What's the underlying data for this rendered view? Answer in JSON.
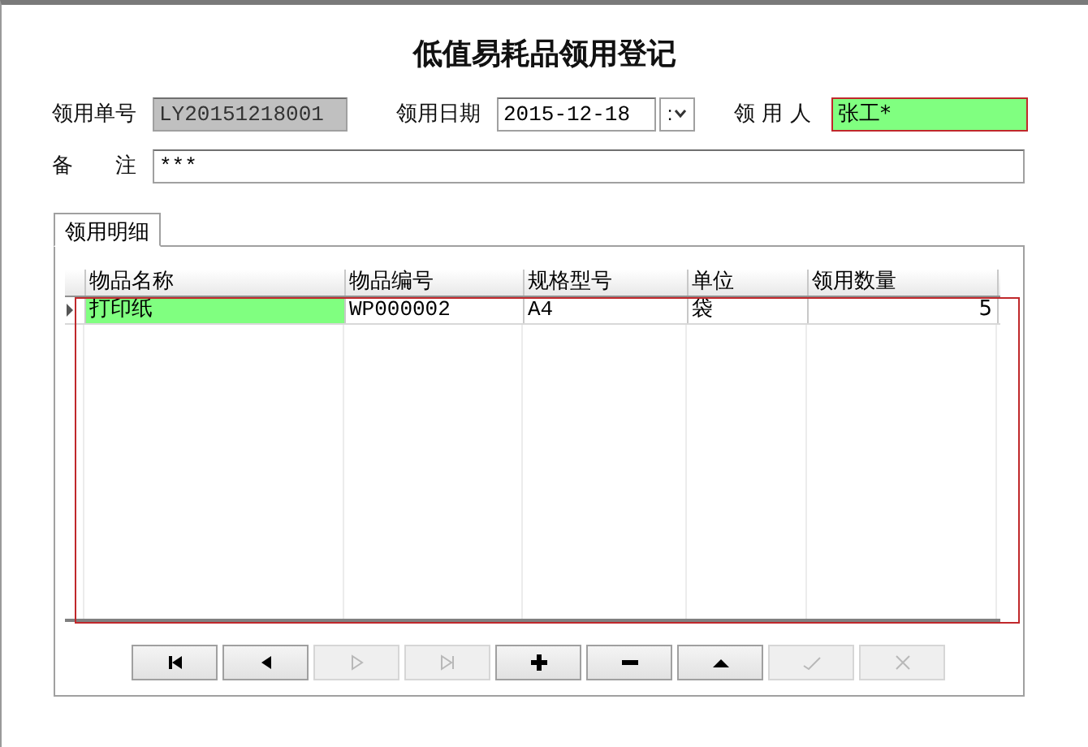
{
  "title": "低值易耗品领用登记",
  "form": {
    "order_no": {
      "label": "领用单号",
      "value": "LY20151218001",
      "disabled": true
    },
    "date": {
      "label": "领用日期",
      "value": "2015-12-18",
      "dropdown": ":"
    },
    "person": {
      "label": "领 用 人",
      "value": "张工*",
      "highlighted": true
    },
    "note": {
      "label": "备　　注",
      "value": "***"
    }
  },
  "tabs": [
    {
      "label": "领用明细",
      "selected": true
    }
  ],
  "table": {
    "columns": [
      "物品名称",
      "物品编号",
      "规格型号",
      "单位",
      "领用数量"
    ],
    "rows": [
      {
        "cells": [
          "打印纸",
          "WP000002",
          "A4",
          "袋",
          "5"
        ],
        "selected": true
      }
    ],
    "highlighted": true
  },
  "navigator": [
    {
      "kind": "first",
      "disabled": false
    },
    {
      "kind": "prev",
      "disabled": false
    },
    {
      "kind": "next",
      "disabled": true
    },
    {
      "kind": "last",
      "disabled": true
    },
    {
      "kind": "add",
      "disabled": false
    },
    {
      "kind": "delete",
      "disabled": false
    },
    {
      "kind": "edit",
      "disabled": false
    },
    {
      "kind": "post",
      "disabled": true
    },
    {
      "kind": "cancel",
      "disabled": true
    }
  ]
}
